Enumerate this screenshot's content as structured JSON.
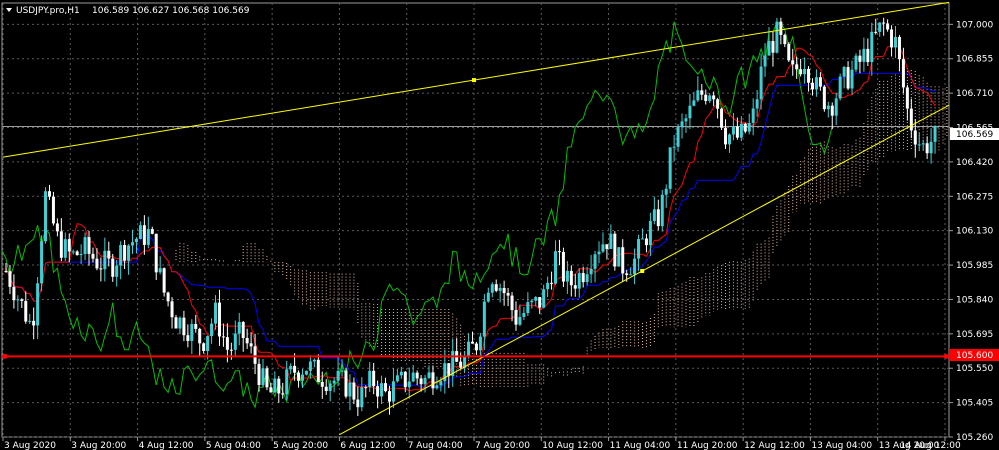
{
  "header": {
    "symbol_title": "USDJPY.pro,H1",
    "ohlc": "106.589 106.627 106.568 106.569"
  },
  "price_labels": {
    "current": "106.569",
    "hline": "105.600"
  },
  "colors": {
    "background": "#000000",
    "grid": "#5a5a5a",
    "bull_candle": "#3fd0d6",
    "bear_candle": "#ffffff",
    "tenkan": "#ff0000",
    "kijun": "#0000ff",
    "chikou": "#00c000",
    "kumo": "#e8b8a0",
    "trendline": "#ffff00",
    "hline": "#ff0000"
  },
  "chart_data": {
    "type": "candlestick",
    "instrument": "USDJPY.pro",
    "timeframe": "H1",
    "ylim": [
      105.26,
      107.09
    ],
    "y_ticks": [
      "107.000",
      "106.855",
      "106.710",
      "106.565",
      "106.420",
      "106.275",
      "106.130",
      "105.985",
      "105.840",
      "105.695",
      "105.550",
      "105.405",
      "105.260"
    ],
    "x_ticks": [
      "3 Aug 2020",
      "3 Aug 20:00",
      "4 Aug 12:00",
      "5 Aug 04:00",
      "5 Aug 20:00",
      "6 Aug 12:00",
      "7 Aug 04:00",
      "7 Aug 20:00",
      "10 Aug 12:00",
      "11 Aug 04:00",
      "11 Aug 20:00",
      "12 Aug 12:00",
      "13 Aug 04:00",
      "13 Aug 20:00",
      "14 Aug 12:00"
    ],
    "close_path": [
      105.96,
      105.84,
      105.72,
      106.28,
      106.08,
      106.02,
      106.05,
      106.0,
      105.98,
      106.06,
      106.1,
      106.12,
      105.88,
      105.76,
      105.72,
      105.66,
      105.78,
      105.62,
      105.7,
      105.58,
      105.44,
      105.46,
      105.54,
      105.56,
      105.52,
      105.5,
      105.48,
      105.42,
      105.5,
      105.44,
      105.48,
      105.52,
      105.5,
      105.54,
      105.56,
      105.58,
      105.66,
      105.96,
      105.88,
      105.76,
      105.8,
      105.84,
      106.02,
      105.9,
      105.95,
      106.06,
      106.1,
      105.98,
      106.0,
      106.12,
      106.2,
      106.5,
      106.6,
      106.7,
      106.74,
      106.54,
      106.52,
      106.58,
      106.88,
      106.96,
      106.78,
      106.86,
      106.72,
      106.66,
      106.76,
      106.82,
      106.9,
      107.0,
      106.92,
      106.6,
      106.48,
      106.52
    ],
    "horizontal_line": 105.6,
    "current_price": 106.569,
    "indicators": [
      "Ichimoku Kinko Hyo: Tenkan-sen (red), Kijun-sen (blue), Chikou Span (green), Kumo cloud (dotted)"
    ],
    "trendlines": [
      {
        "from": [
          "3 Aug 2020",
          106.44
        ],
        "to": [
          "14 Aug 12:00",
          107.09
        ]
      },
      {
        "from": [
          "6 Aug 12:00",
          105.27
        ],
        "to": [
          "14 Aug 12:00",
          106.65
        ]
      }
    ]
  }
}
